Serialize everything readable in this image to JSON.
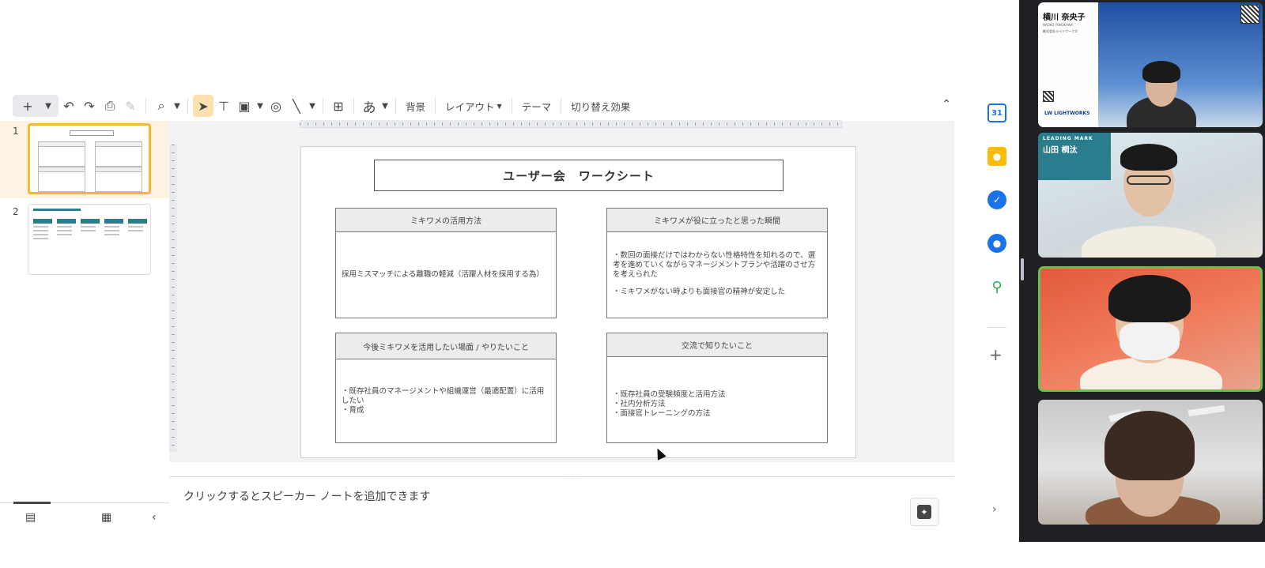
{
  "toolbar": {
    "background_label": "背景",
    "layout_label": "レイアウト",
    "theme_label": "テーマ",
    "transition_label": "切り替え効果",
    "input_tool_label": "あ"
  },
  "filmstrip": {
    "slides": [
      {
        "number": "1",
        "title": "ユーザー会　ワークシート"
      },
      {
        "number": "2",
        "title": "ミキワメでできること"
      }
    ]
  },
  "slide": {
    "title": "ユーザー会　ワークシート",
    "cards": [
      {
        "heading": "ミキワメの活用方法",
        "lines": [
          "採用ミスマッチによる離職の軽減（活躍人材を採用する為）"
        ]
      },
      {
        "heading": "ミキワメが役に立ったと思った瞬間",
        "lines": [
          "・数回の面接だけではわからない性格特性を知れるので、選考を進めていくながらマネージメントプランや活躍のさせ方を考えられた",
          "",
          "・ミキワメがない時よりも面接官の精神が安定した"
        ]
      },
      {
        "heading": "今後ミキワメを活用したい場面 / やりたいこと",
        "lines": [
          "・既存社員のマネージメントや組織運営（最適配置）に活用したい",
          "・育成"
        ]
      },
      {
        "heading": "交流で知りたいこと",
        "lines": [
          "・既存社員の受験頻度と活用方法",
          "・社内分析方法",
          "・面接官トレーニングの方法"
        ]
      }
    ]
  },
  "notes": {
    "placeholder": "クリックするとスピーカー ノートを追加できます"
  },
  "sidepanel": {
    "calendar_day": "31"
  },
  "participants": [
    {
      "card_name": "横川 奈央子",
      "card_roman": "NAOKO YOKOKAWA",
      "card_role": "株式会社ライトワークス",
      "card_logo": "LW LIGHTWORKS"
    },
    {
      "banner_brand": "LEADING MARK",
      "banner_name": "山田 桐汰"
    },
    {},
    {}
  ]
}
